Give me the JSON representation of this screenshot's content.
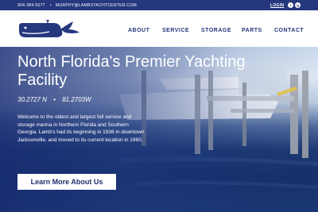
{
  "topbar": {
    "phone": "904-384-5577",
    "separator": "•",
    "email": "MURPHY@LAMBSYACHTCENTER.COM",
    "login": "LOGIN",
    "social": [
      "f",
      "ig"
    ]
  },
  "nav": {
    "items": [
      "ABOUT",
      "SERVICE",
      "STORAGE",
      "PARTS",
      "CONTACT"
    ]
  },
  "hero": {
    "title": "North Florida's Premier Yachting Facility",
    "lat": "30.2727 N",
    "coord_sep": "•",
    "lon": "81.2703W",
    "description": "Welcome to the oldest and largest full service and storage marina in Northern Florida and Southern Georgia. Lamb's had its beginning in 1936 in downtown Jacksonville, and moved to its current location in 1960.",
    "cta": "Learn More About Us"
  },
  "colors": {
    "brand": "#25377d",
    "white": "#ffffff"
  },
  "icons": [
    "whale-logo-icon",
    "facebook-icon",
    "instagram-icon"
  ]
}
